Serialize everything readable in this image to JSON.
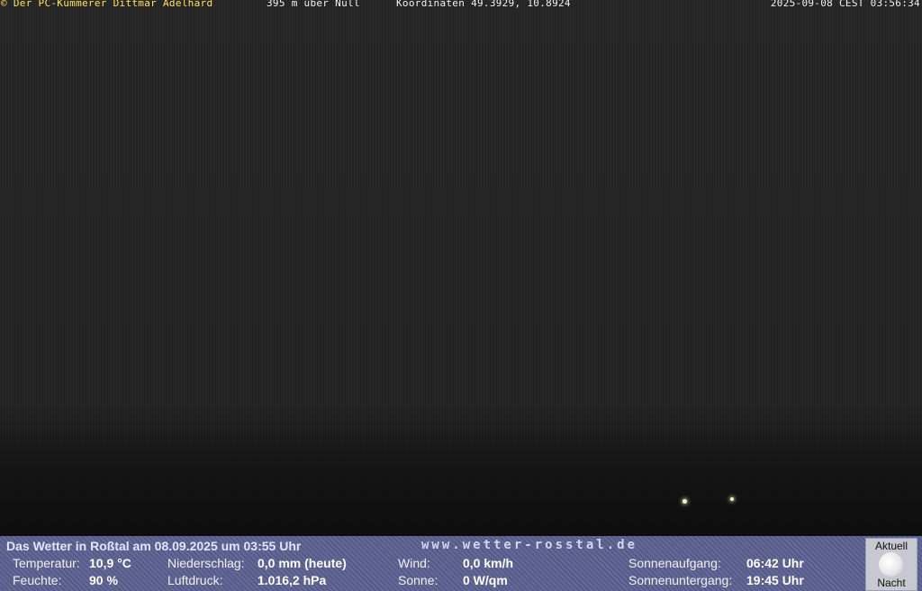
{
  "overlay_top": {
    "copyright": "© Der PC-Kümmerer Dittmar Adelhard",
    "altitude": "395 m über Null",
    "coordinates": "Koordinaten 49.3929, 10.8924",
    "datetime": "2025-09-08 CEST 03:56:34"
  },
  "weather": {
    "title": "Das Wetter in Roßtal am 08.09.2025 um 03:55 Uhr",
    "url": "www.wetter-rosstal.de",
    "temperature_label": "Temperatur:",
    "temperature_value": "10,9 °C",
    "humidity_label": "Feuchte:",
    "humidity_value": "90 %",
    "precip_label": "Niederschlag:",
    "precip_value": "0,0 mm (heute)",
    "pressure_label": "Luftdruck:",
    "pressure_value": "1.016,2 hPa",
    "wind_label": "Wind:",
    "wind_value": "0,0 km/h",
    "sun_label": "Sonne:",
    "sun_value": "0 W/qm",
    "sunrise_label": "Sonnenaufgang:",
    "sunrise_value": "06:42 Uhr",
    "sunset_label": "Sonnenuntergang:",
    "sunset_value": "19:45 Uhr"
  },
  "moon": {
    "label_top": "Aktuell",
    "label_bottom": "Nacht",
    "icon": "moon-icon"
  }
}
